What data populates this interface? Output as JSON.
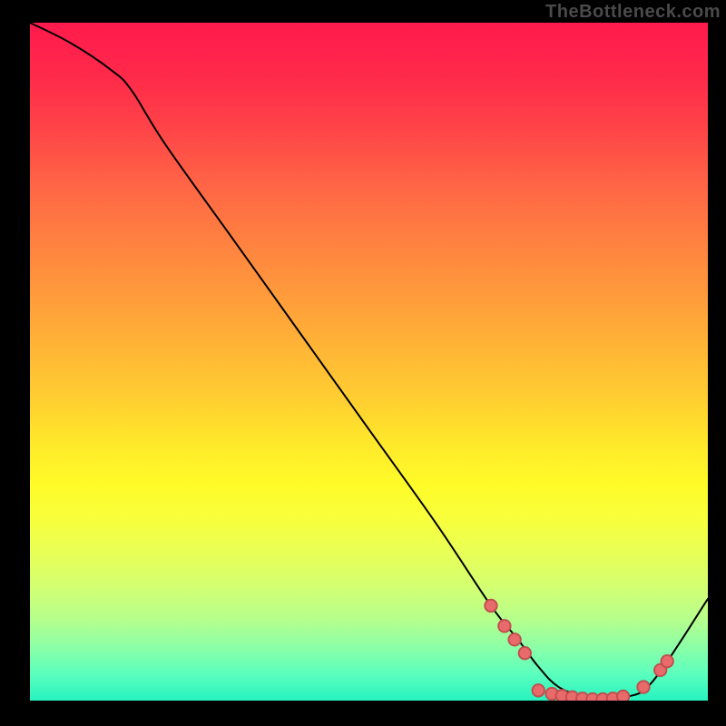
{
  "watermark": "TheBottleneck.com",
  "colors": {
    "background": "#000000",
    "curve": "#000000",
    "dots": "#e86a6a",
    "dotStroke": "#c24d4d"
  },
  "chart_data": {
    "type": "line",
    "title": "",
    "xlabel": "",
    "ylabel": "",
    "xlim": [
      0,
      100
    ],
    "ylim": [
      0,
      100
    ],
    "series": [
      {
        "name": "curve",
        "x": [
          0,
          6,
          12,
          15,
          20,
          30,
          40,
          50,
          60,
          68,
          72,
          75,
          78,
          82,
          85,
          88,
          92,
          100
        ],
        "y": [
          100,
          97,
          93,
          90,
          82,
          68,
          54,
          40,
          26,
          14,
          9,
          5,
          2,
          0.5,
          0,
          0.5,
          3,
          15
        ]
      }
    ],
    "markers": [
      {
        "x": 68,
        "y": 14
      },
      {
        "x": 70,
        "y": 11
      },
      {
        "x": 71.5,
        "y": 9
      },
      {
        "x": 73,
        "y": 7
      },
      {
        "x": 75,
        "y": 1.5
      },
      {
        "x": 77,
        "y": 1.0
      },
      {
        "x": 78.5,
        "y": 0.7
      },
      {
        "x": 80,
        "y": 0.5
      },
      {
        "x": 81.5,
        "y": 0.3
      },
      {
        "x": 83,
        "y": 0.2
      },
      {
        "x": 84.5,
        "y": 0.2
      },
      {
        "x": 86,
        "y": 0.3
      },
      {
        "x": 87.5,
        "y": 0.6
      },
      {
        "x": 90.5,
        "y": 2.0
      },
      {
        "x": 93,
        "y": 4.5
      },
      {
        "x": 94,
        "y": 5.8
      }
    ]
  }
}
